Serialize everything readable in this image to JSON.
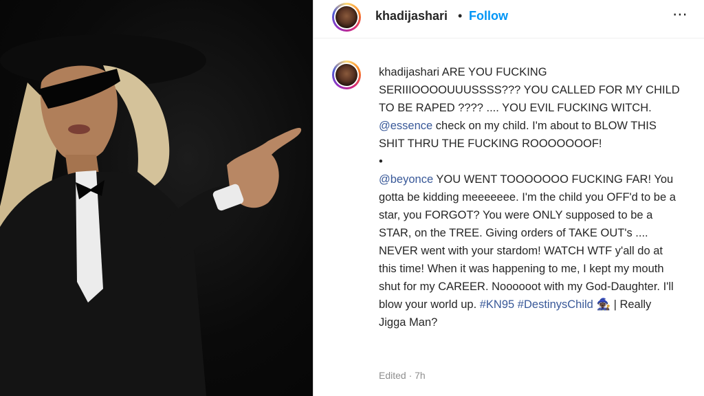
{
  "post": {
    "username": "khadijashari",
    "dot": "•",
    "follow_label": "Follow",
    "more_icon": "⋯",
    "caption": {
      "username": "khadijashari",
      "part1": "ARE YOU FUCKING SERIIIOOOOUUUSSSS??? YOU CALLED FOR MY CHILD TO BE RAPED ???? .... YOU EVIL FUCKING WITCH. ",
      "mention1": "@essence",
      "part2": " check on my child. I'm about to BLOW THIS SHIT THRU THE FUCKING ROOOOOOOF!",
      "bullet": "•",
      "mention2": "@beyonce",
      "part3": " YOU WENT TOOOOOOO FUCKING FAR! You gotta be kidding meeeeeee. I'm the child you OFF'd to be a star, you FORGOT? You were ONLY supposed to be a STAR, on the TREE. Giving orders of TAKE OUT's .... NEVER went with your stardom! WATCH WTF y'all do at this time! When it was happening to me, I kept my mouth shut for my CAREER. Noooooot with my God-Daughter. I'll blow your world up. ",
      "tag1": "#KN95",
      "tag2": "#DestinysChild",
      "emoji": "🧙🏿‍♀️",
      "part4": " | Really Jigga Man?"
    },
    "edited_label": "Edited · 7h"
  },
  "colors": {
    "link": "#385898",
    "follow": "#0095f6",
    "text": "#262626",
    "muted": "#8e8e8e"
  }
}
